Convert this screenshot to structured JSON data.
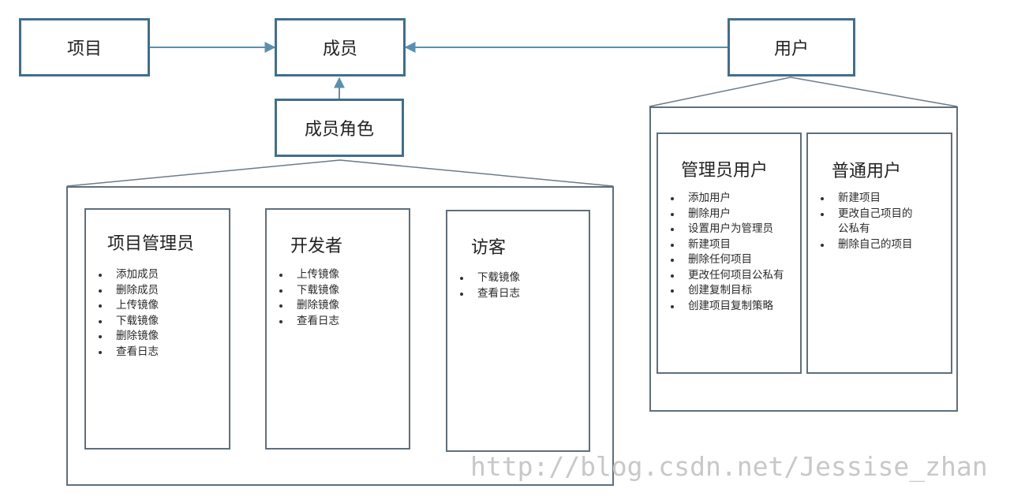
{
  "nodes": {
    "project": "项目",
    "member": "成员",
    "user": "用户",
    "member_role": "成员角色"
  },
  "roles": {
    "project_admin": {
      "title": "项目管理员",
      "items": [
        "添加成员",
        "删除成员",
        "上传镜像",
        "下载镜像",
        "删除镜像",
        "查看日志"
      ]
    },
    "developer": {
      "title": "开发者",
      "items": [
        "上传镜像",
        "下载镜像",
        "删除镜像",
        "查看日志"
      ]
    },
    "guest": {
      "title": "访客",
      "items": [
        "下载镜像",
        "查看日志"
      ]
    }
  },
  "user_types": {
    "admin_user": {
      "title": "管理员用户",
      "items": [
        "添加用户",
        "删除用户",
        "设置用户为管理员",
        "新建项目",
        "删除任何项目",
        "更改任何项目公私有",
        "创建复制目标",
        "创建项目复制策略"
      ]
    },
    "normal_user": {
      "title": "普通用户",
      "items": [
        "新建项目",
        "更改自己项目的",
        "公私有",
        "删除自己的项目"
      ]
    }
  },
  "watermark": "http://blog.csdn.net/Jessise_zhan",
  "colors": {
    "node_border": "#3f6f8e",
    "panel_border": "#5f6f7c",
    "connector": "#5b8fb0"
  }
}
